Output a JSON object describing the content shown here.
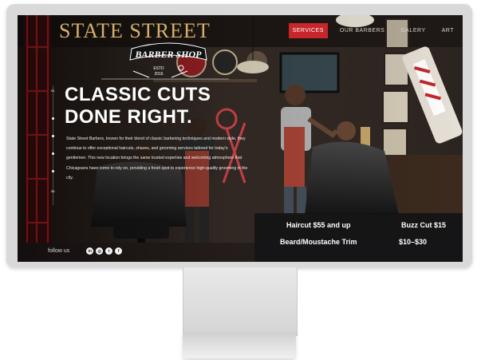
{
  "header": {
    "site_title": "STATE STREET",
    "logo": {
      "line1": "BARBER SHOP",
      "line2": "ESTD",
      "line3": "2016"
    }
  },
  "nav": {
    "items": [
      {
        "label": "SERVICES",
        "active": true
      },
      {
        "label": "OUR BARBERS",
        "active": false
      },
      {
        "label": "GALERY",
        "active": false
      },
      {
        "label": "ART",
        "active": false
      }
    ]
  },
  "side_nav": {
    "labels": [
      "01",
      "05"
    ]
  },
  "hero": {
    "headline_line1": "CLASSIC CUTS",
    "headline_line2": "DONE RIGHT.",
    "body": "State Street Barbers, known for their blend of classic barbering techniques and modern style, they continue to offer exceptional haircuts, shaves, and grooming services tailored for today's gentlemen. This new location brings the same trusted expertise and welcoming atmosphere that Chicagoans have come to rely on, providing a fresh spot to experience high-quality grooming in the city."
  },
  "prices": {
    "haircut": "Haircut  $55 and up",
    "buzz_cut": "Buzz Cut  $15",
    "beard_label": "Beard/Moustache Trim",
    "beard_price": "$10–$30"
  },
  "footer": {
    "follow_label": "follow us",
    "social_icons": [
      "linkedin-icon",
      "instagram-icon",
      "twitter-icon",
      "facebook-icon"
    ],
    "social_glyphs": [
      "in",
      "◎",
      "t",
      "f"
    ]
  },
  "colors": {
    "accent_red": "#c7262b",
    "title_gold": "#d6b06a",
    "price_panel": "#141416"
  }
}
